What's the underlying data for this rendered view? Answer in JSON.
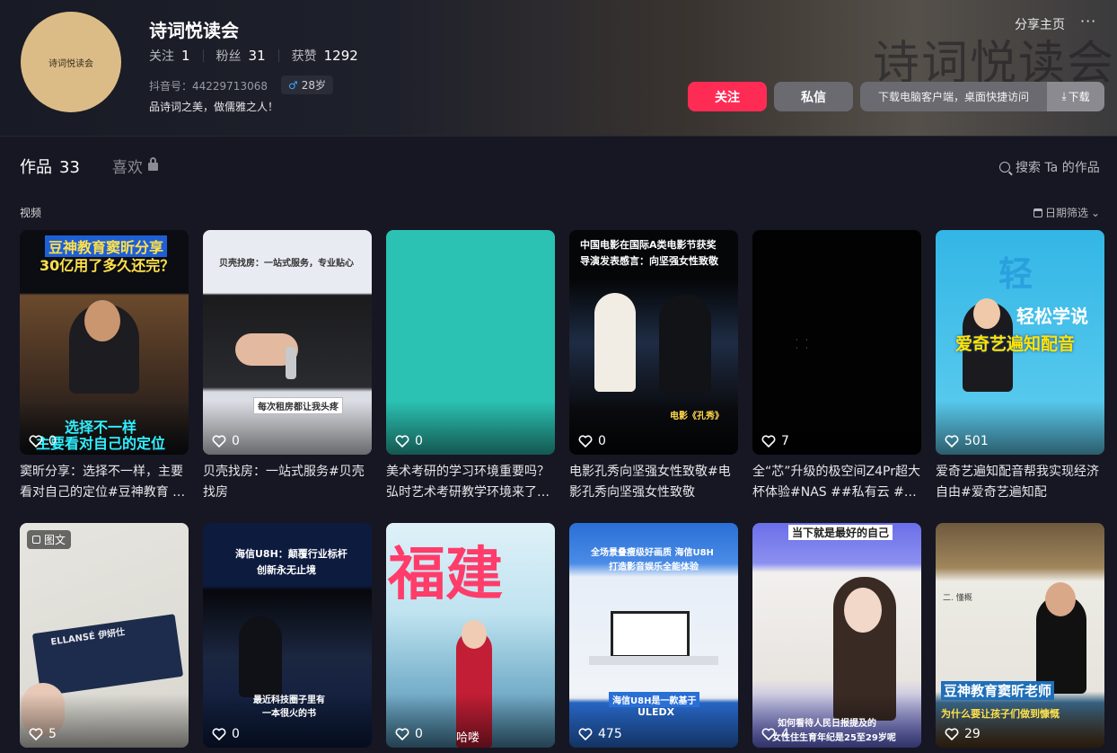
{
  "profile": {
    "avatar_text": "诗词悦读会",
    "watermark": "诗词悦读会",
    "name": "诗词悦读会",
    "following_label": "关注",
    "following": "1",
    "followers_label": "粉丝",
    "followers": "31",
    "likes_label": "获赞",
    "likes": "1292",
    "douyin_id": "抖音号：44229713068",
    "age": "28岁",
    "bio": "品诗词之美，做儒雅之人！"
  },
  "actions": {
    "share": "分享主页",
    "more": "···",
    "follow": "关注",
    "message": "私信",
    "download_hint": "下载电脑客户端，桌面快捷访问",
    "download": "下载"
  },
  "tabs": {
    "works_label": "作品",
    "works_count": "33",
    "likes_label": "喜欢",
    "search": "搜索 Ta 的作品"
  },
  "section": {
    "label": "视频",
    "date_filter": "日期筛选"
  },
  "videos": [
    {
      "likes": "0",
      "title": "窦昕分享：选择不一样，主要看对自己的定位#豆神教育 …",
      "overlay_top": "豆神教育窦昕分享",
      "overlay_top2": "30亿用了多久还完？",
      "overlay_bottom": "选择不一样",
      "overlay_bottom2": "主要看对自己的定位"
    },
    {
      "likes": "0",
      "title": "贝壳找房：一站式服务#贝壳找房",
      "overlay_top": "贝壳找房：一站式服务，专业贴心",
      "overlay_bottom": "每次租房都让我头疼"
    },
    {
      "likes": "0",
      "title": "美术考研的学习环境重要吗？弘时艺术考研教学环境来了…"
    },
    {
      "likes": "0",
      "title": "电影孔秀向坚强女性致敬#电影孔秀向坚强女性致敬",
      "overlay_top": "中国电影在国际A类电影节获奖",
      "overlay_top2": "导演发表感言：向坚强女性致敬",
      "overlay_bottom": "电影《孔秀》"
    },
    {
      "likes": "7",
      "title": "全“芯”升级的极空间Z4Pr超大杯体验#NAS ##私有云 #…"
    },
    {
      "likes": "501",
      "title": "爱奇艺遍知配音帮我实现经济自由#爱奇艺遍知配",
      "overlay_top": "轻松学说",
      "overlay_bottom": "爱奇艺遍知配音"
    },
    {
      "likes": "5",
      "title": "",
      "tag": "图文",
      "overlay_top": "ELLANSÉ 伊妍仕"
    },
    {
      "likes": "0",
      "title": "",
      "overlay_top": "海信U8H：颠覆行业标杆",
      "overlay_top2": "创新永无止境",
      "overlay_bottom": "最近科技圈子里有",
      "overlay_bottom2": "一本很火的书"
    },
    {
      "likes": "0",
      "title": "",
      "overlay_top": "福建",
      "overlay_bottom": "哈喽"
    },
    {
      "likes": "475",
      "title": "",
      "overlay_top": "全场景叠瘦级好画质 海信U8H",
      "overlay_top2": "打造影音娱乐全能体验",
      "overlay_bottom": "海信U8H是一款基于",
      "overlay_bottom2": "ULEDX"
    },
    {
      "likes": "4",
      "title": "",
      "overlay_top": "当下就是最好的自己",
      "overlay_bottom": "如何看待人民日报提及的",
      "overlay_bottom2": "女性住生育年纪是25至29岁呢"
    },
    {
      "likes": "29",
      "title": "",
      "overlay_top": "二. 懂概",
      "overlay_bottom": "豆神教育窦昕老师",
      "overlay_bottom2": "为什么要让孩子们做到慷慨"
    }
  ],
  "colors": {
    "accent": "#fe2c55",
    "bg": "#161722",
    "teal": "#2bc2b3"
  }
}
